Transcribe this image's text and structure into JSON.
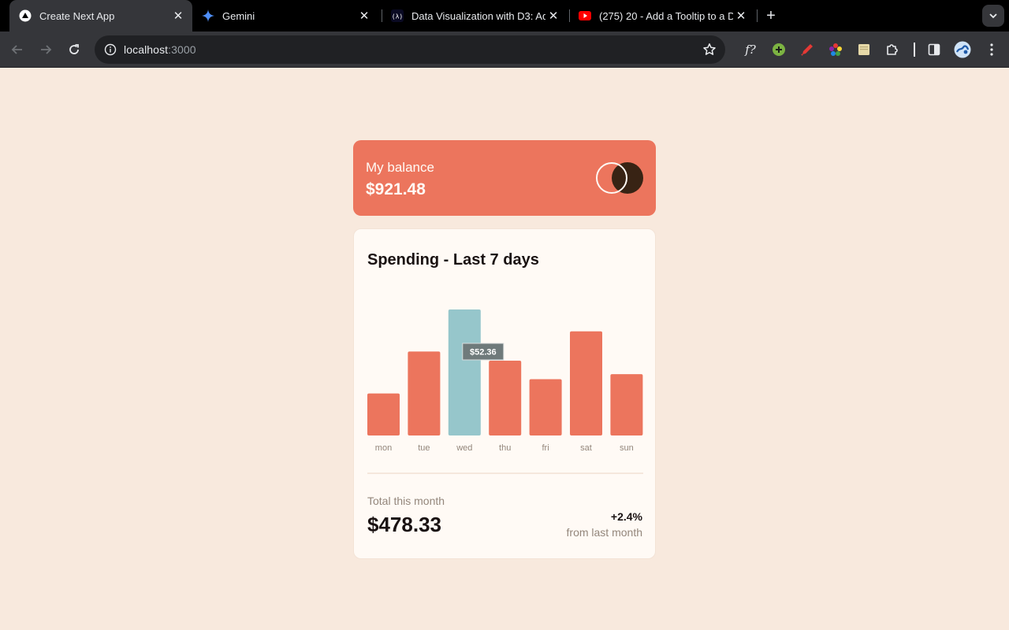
{
  "browser": {
    "tabs": [
      {
        "title": "Create Next App",
        "icon": "nextjs-icon",
        "active": true
      },
      {
        "title": "Gemini",
        "icon": "gemini-icon",
        "active": false
      },
      {
        "title": "Data Visualization with D3: Ad",
        "icon": "freecodecamp-icon",
        "active": false
      },
      {
        "title": "(275) 20 - Add a Tooltip to a D",
        "icon": "youtube-icon",
        "active": false
      }
    ],
    "url_host": "localhost",
    "url_port": ":3000",
    "toolbar_text": {
      "formula": "f?"
    }
  },
  "balance": {
    "label": "My balance",
    "amount": "$921.48"
  },
  "spending": {
    "title": "Spending - Last 7 days",
    "tooltip": "$52.36",
    "total_label": "Total this month",
    "total_amount": "$478.33",
    "change_pct": "+2.4%",
    "change_label": "from last month"
  },
  "colors": {
    "bar": "#ec755d",
    "bar_active": "#96c6cb",
    "page_bg": "#f8e9dd",
    "card_bg": "#fffaf5",
    "balance_bg": "#ec755d",
    "logo_dark": "#382314"
  },
  "chart_data": {
    "type": "bar",
    "categories": [
      "mon",
      "tue",
      "wed",
      "thu",
      "fri",
      "sat",
      "sun"
    ],
    "values": [
      17.45,
      34.91,
      52.36,
      31.07,
      23.39,
      43.28,
      25.48
    ],
    "highlighted": "wed",
    "xlabel": "",
    "ylabel": "",
    "grid": false
  }
}
